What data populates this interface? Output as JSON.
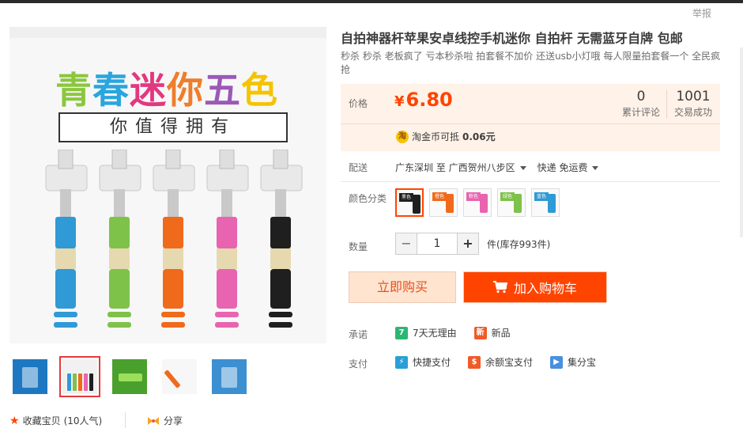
{
  "header": {
    "report_label": "举报"
  },
  "gallery": {
    "headline_chars": [
      {
        "ch": "青",
        "color": "#8cc63e"
      },
      {
        "ch": "春",
        "color": "#2aa5de"
      },
      {
        "ch": "迷",
        "color": "#e2387f"
      },
      {
        "ch": "你",
        "color": "#ee7d2c"
      },
      {
        "ch": "五",
        "color": "#9b59b6"
      },
      {
        "ch": "色",
        "color": "#f5c300"
      }
    ],
    "subline": "你值得拥有",
    "stick_colors": [
      "#2f9ad6",
      "#7ec24a",
      "#f06a1c",
      "#e864b0",
      "#1f1f1f"
    ],
    "thumbnails": [
      {
        "name": "thumb-1",
        "color": "#1d78c1"
      },
      {
        "name": "thumb-2",
        "color": "#f1f1f1"
      },
      {
        "name": "thumb-3",
        "color": "#4aa02c"
      },
      {
        "name": "thumb-4",
        "color": "#f7f7f7"
      },
      {
        "name": "thumb-5",
        "color": "#3c8fd0"
      }
    ]
  },
  "product": {
    "title": "自拍神器杆苹果安卓线控手机迷你 自拍杆 无需蓝牙自牌 包邮",
    "subtitle": "秒杀 秒杀 老板疯了 亏本秒杀啦 拍套餐不加价 还送usb小灯哦 每人限量拍套餐一个 全民疯抢"
  },
  "price": {
    "label": "价格",
    "currency": "¥",
    "value": "6.80",
    "reviews_count": "0",
    "reviews_label": "累计评论",
    "sales_count": "1001",
    "sales_label": "交易成功",
    "coin_icon": "淘",
    "coin_text": "淘金币可抵",
    "coin_amount": "0.06元"
  },
  "shipping": {
    "label": "配送",
    "from_to": "广东深圳 至 广西贺州八步区",
    "method": "快递 免运费"
  },
  "color": {
    "label": "颜色分类",
    "swatches": [
      {
        "tag": "黑色",
        "color": "#1f1f1f"
      },
      {
        "tag": "橙色",
        "color": "#f06a1c"
      },
      {
        "tag": "粉色",
        "color": "#e864b0"
      },
      {
        "tag": "绿色",
        "color": "#7ec24a"
      },
      {
        "tag": "蓝色",
        "color": "#2f9ad6"
      }
    ]
  },
  "quantity": {
    "label": "数量",
    "minus": "−",
    "value": "1",
    "plus": "+",
    "stock": "件(库存993件)"
  },
  "actions": {
    "buy_now": "立即购买",
    "add_to_cart": "加入购物车"
  },
  "promise": {
    "label": "承诺",
    "items": [
      {
        "icon": "7",
        "icon_color": "#2bb673",
        "text": "7天无理由"
      },
      {
        "icon": "新",
        "icon_color": "#f05a28",
        "text": "新品"
      }
    ]
  },
  "payment": {
    "label": "支付",
    "items": [
      {
        "icon": "⚡",
        "icon_color": "#2a9fd6",
        "text": "快捷支付"
      },
      {
        "icon": "$",
        "icon_color": "#f05a28",
        "text": "余额宝支付"
      },
      {
        "icon": "▶",
        "icon_color": "#4a8fe0",
        "text": "集分宝"
      }
    ]
  },
  "footer": {
    "favorite": "收藏宝贝",
    "favorite_count": "(10人气)",
    "share": "分享"
  }
}
